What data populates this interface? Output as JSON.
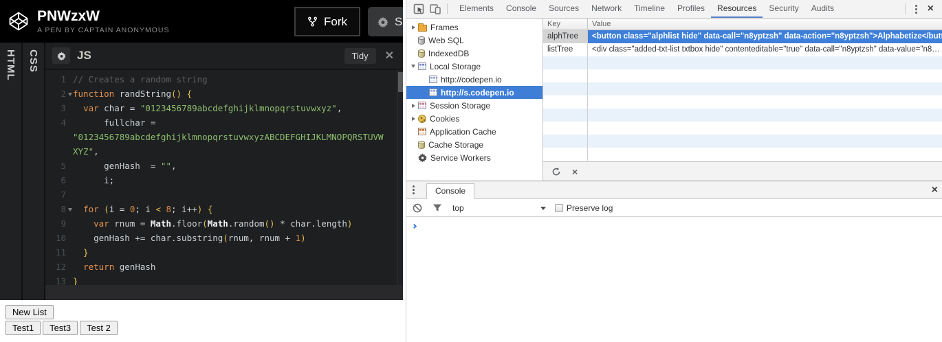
{
  "pen": {
    "title": "PNWzxW",
    "subtitle": "A PEN BY CAPTAIN ANONYMOUS",
    "fork_label": "Fork",
    "settings_label": "Se",
    "tidy_label": "Tidy",
    "tabs": {
      "html": "HTML",
      "css": "CSS",
      "js": "JS"
    }
  },
  "editor": {
    "lines": [
      {
        "num": "1",
        "tokens": [
          [
            "c",
            "// Creates a random string"
          ]
        ]
      },
      {
        "num": "2",
        "fold": true,
        "tokens": [
          [
            "k",
            "function"
          ],
          [
            "p",
            " randString"
          ],
          [
            "b",
            "()"
          ],
          [
            "p",
            " "
          ],
          [
            "b",
            "{"
          ]
        ]
      },
      {
        "num": "3",
        "tokens": [
          [
            "p",
            "  "
          ],
          [
            "k",
            "var"
          ],
          [
            "p",
            " char = "
          ],
          [
            "s",
            "\"0123456789abcdefghijklmnopqrstuvwxyz\""
          ],
          [
            "p",
            ","
          ]
        ]
      },
      {
        "num": "4",
        "tokens": [
          [
            "p",
            "      fullchar ="
          ]
        ]
      },
      {
        "num": "",
        "tokens": [
          [
            "s",
            "\"0123456789abcdefghijklmnopqrstuvwxyzABCDEFGHIJKLMNOPQRSTUVW"
          ]
        ]
      },
      {
        "num": "",
        "tokens": [
          [
            "s",
            "XYZ\""
          ],
          [
            "p",
            ","
          ]
        ]
      },
      {
        "num": "5",
        "tokens": [
          [
            "p",
            "      genHash  = "
          ],
          [
            "s",
            "\"\""
          ],
          [
            "p",
            ","
          ]
        ]
      },
      {
        "num": "6",
        "tokens": [
          [
            "p",
            "      i;"
          ]
        ]
      },
      {
        "num": "7",
        "tokens": []
      },
      {
        "num": "8",
        "fold": true,
        "tokens": [
          [
            "p",
            "  "
          ],
          [
            "k",
            "for"
          ],
          [
            "p",
            " "
          ],
          [
            "b",
            "("
          ],
          [
            "p",
            "i = "
          ],
          [
            "n",
            "0"
          ],
          [
            "p",
            "; i "
          ],
          [
            "b",
            "<"
          ],
          [
            "p",
            " "
          ],
          [
            "n",
            "8"
          ],
          [
            "p",
            "; i++"
          ],
          [
            "b",
            ")"
          ],
          [
            "p",
            " "
          ],
          [
            "b",
            "{"
          ]
        ]
      },
      {
        "num": "9",
        "tokens": [
          [
            "p",
            "    "
          ],
          [
            "k",
            "var"
          ],
          [
            "p",
            " rnum = "
          ],
          [
            "m",
            "Math"
          ],
          [
            "p",
            ".floor"
          ],
          [
            "b",
            "("
          ],
          [
            "m",
            "Math"
          ],
          [
            "p",
            ".random"
          ],
          [
            "b",
            "()"
          ],
          [
            "p",
            " * char.length"
          ],
          [
            "b",
            ")"
          ]
        ]
      },
      {
        "num": "10",
        "tokens": [
          [
            "p",
            "    genHash += char.substring"
          ],
          [
            "b",
            "("
          ],
          [
            "p",
            "rnum, rnum + "
          ],
          [
            "n",
            "1"
          ],
          [
            "b",
            ")"
          ]
        ]
      },
      {
        "num": "11",
        "tokens": [
          [
            "p",
            "  "
          ],
          [
            "b",
            "}"
          ]
        ]
      },
      {
        "num": "12",
        "tokens": [
          [
            "p",
            "  "
          ],
          [
            "k",
            "return"
          ],
          [
            "p",
            " genHash"
          ]
        ]
      },
      {
        "num": "13",
        "tokens": [
          [
            "b",
            "}"
          ]
        ]
      }
    ]
  },
  "preview": {
    "new_list_label": "New List",
    "test_buttons": [
      "Test1",
      "Test3",
      "Test 2"
    ]
  },
  "devtools": {
    "tabs": [
      "Elements",
      "Console",
      "Sources",
      "Network",
      "Timeline",
      "Profiles",
      "Resources",
      "Security",
      "Audits"
    ],
    "selected_tab": "Resources",
    "sidebar": [
      {
        "label": "Frames",
        "icon": "folder",
        "disclosure": "collapsed"
      },
      {
        "label": "Web SQL",
        "icon": "database-gray"
      },
      {
        "label": "IndexedDB",
        "icon": "database-tan"
      },
      {
        "label": "Local Storage",
        "icon": "table-blue",
        "disclosure": "expanded"
      },
      {
        "label": "http://codepen.io",
        "icon": "table-child",
        "child": true
      },
      {
        "label": "http://s.codepen.io",
        "icon": "table-child",
        "child": true,
        "selected": true
      },
      {
        "label": "Session Storage",
        "icon": "table-pink",
        "disclosure": "collapsed"
      },
      {
        "label": "Cookies",
        "icon": "cookie",
        "disclosure": "collapsed"
      },
      {
        "label": "Application Cache",
        "icon": "table-orange"
      },
      {
        "label": "Cache Storage",
        "icon": "database-tan"
      },
      {
        "label": "Service Workers",
        "icon": "gear"
      }
    ],
    "grid": {
      "columns": [
        "Key",
        "Value"
      ],
      "rows": [
        {
          "key": "alphTree",
          "value": "<button class=\"alphlist hide\" data-call=\"n8yptzsh\" data-action=\"n8yptzsh\">Alphabetize</button> <…",
          "selected": true
        },
        {
          "key": "listTree",
          "value": "<div class=\"added-txt-list txtbox hide\" contenteditable=\"true\" data-call=\"n8yptzsh\" data-value=\"n8…"
        }
      ],
      "empty_row_count": 8
    },
    "console": {
      "tab_label": "Console",
      "context_label": "top",
      "preserve_log_label": "Preserve log"
    },
    "colors": {
      "selection_blue": "#3d7fd9",
      "sidebar_selection_blue": "#3e7ed7",
      "tab_underline_blue": "#5780c9",
      "console_prompt_blue": "#3679e0"
    }
  },
  "code_colors": {
    "keyword": "#e2914e",
    "string": "#8fbe6e",
    "number": "#dd8a44",
    "bracket": "#e3c152",
    "comment": "#5d6164"
  }
}
